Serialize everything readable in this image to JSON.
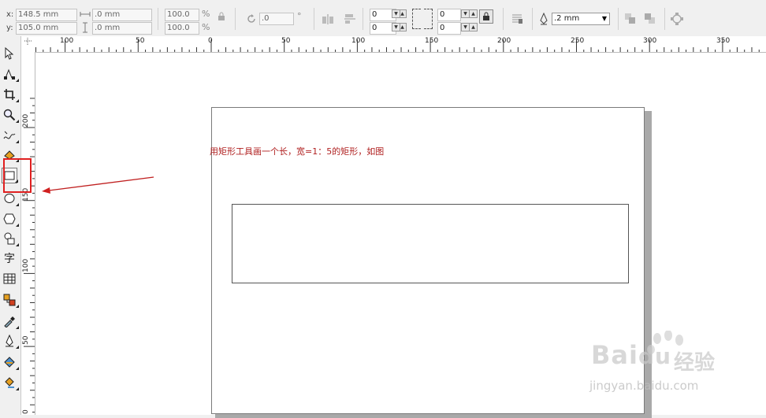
{
  "propbar": {
    "x_label": "x:",
    "x_value": "148.5 mm",
    "y_label": "y:",
    "y_value": "105.0 mm",
    "width_value": ".0 mm",
    "height_value": ".0 mm",
    "scale_x": "100.0",
    "scale_y": "100.0",
    "percent": "%",
    "rotation": ".0",
    "degree": "°",
    "corner_tl": "0",
    "corner_bl": "0",
    "corner_tr": "0",
    "corner_br": "0",
    "outline_width": ".2 mm"
  },
  "ruler_top": {
    "labels": [
      "100",
      "50",
      "0",
      "50",
      "100",
      "150",
      "200",
      "250",
      "300",
      "350"
    ]
  },
  "ruler_left": {
    "labels": [
      "200",
      "150",
      "100",
      "50",
      "0"
    ]
  },
  "annotation": {
    "text": "用矩形工具画一个长，宽=1：5的矩形，如图"
  },
  "watermark": {
    "brand": "Bai",
    "brand_suffix": "经验",
    "url": "jingyan.baidu.com"
  },
  "colors": {
    "annotation": "#b02020",
    "highlight": "#e02020",
    "canvas": "#ffffff"
  }
}
